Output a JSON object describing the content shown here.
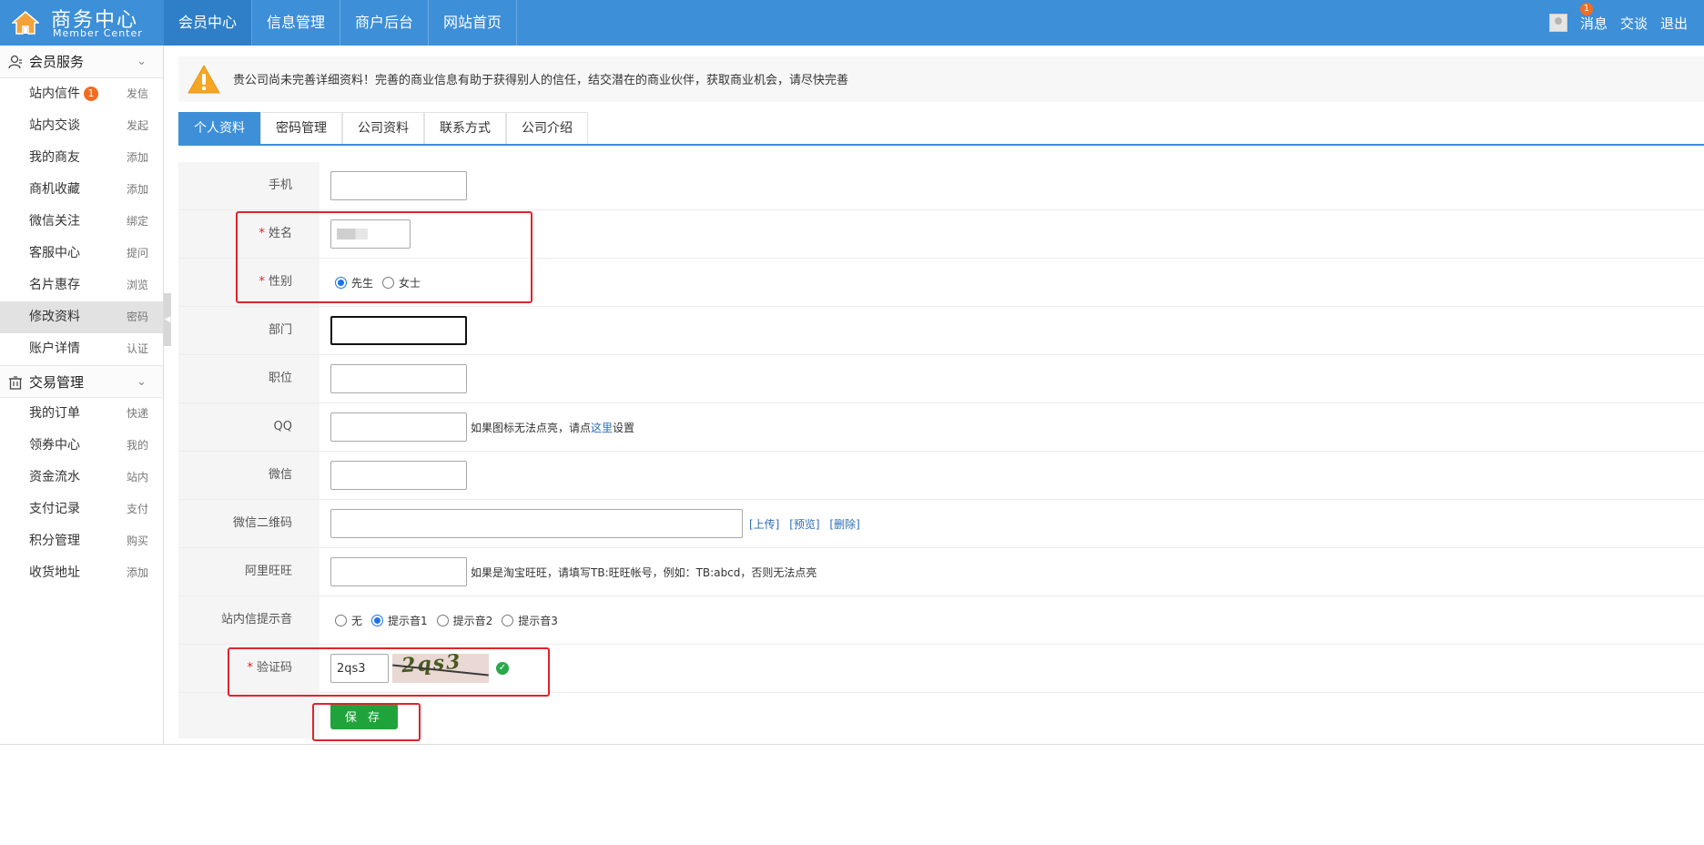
{
  "header": {
    "logo_title": "商务中心",
    "logo_subtitle": "Member Center",
    "nav": [
      {
        "label": "会员中心"
      },
      {
        "label": "信息管理"
      },
      {
        "label": "商户后台"
      },
      {
        "label": "网站首页"
      }
    ],
    "messages_label": "消息",
    "messages_badge": "1",
    "chat_label": "交谈",
    "logout_label": "退出"
  },
  "sidebar": {
    "sections": [
      {
        "title": "会员服务",
        "items": [
          {
            "label": "站内信件",
            "badge": "1",
            "action": "发信"
          },
          {
            "label": "站内交谈",
            "action": "发起"
          },
          {
            "label": "我的商友",
            "action": "添加"
          },
          {
            "label": "商机收藏",
            "action": "添加"
          },
          {
            "label": "微信关注",
            "action": "绑定"
          },
          {
            "label": "客服中心",
            "action": "提问"
          },
          {
            "label": "名片惠存",
            "action": "浏览"
          },
          {
            "label": "修改资料",
            "action": "密码"
          },
          {
            "label": "账户详情",
            "action": "认证"
          }
        ]
      },
      {
        "title": "交易管理",
        "items": [
          {
            "label": "我的订单",
            "action": "快递"
          },
          {
            "label": "领券中心",
            "action": "我的"
          },
          {
            "label": "资金流水",
            "action": "站内"
          },
          {
            "label": "支付记录",
            "action": "支付"
          },
          {
            "label": "积分管理",
            "action": "购买"
          },
          {
            "label": "收货地址",
            "action": "添加"
          }
        ]
      }
    ]
  },
  "notice": {
    "text": "贵公司尚未完善详细资料！完善的商业信息有助于获得别人的信任，结交潜在的商业伙伴，获取商业机会，请尽快完善"
  },
  "tabs": [
    {
      "label": "个人资料"
    },
    {
      "label": "密码管理"
    },
    {
      "label": "公司资料"
    },
    {
      "label": "联系方式"
    },
    {
      "label": "公司介绍"
    }
  ],
  "form": {
    "mobile_label": "手机",
    "mobile_value": "",
    "name_label": "姓名",
    "gender_label": "性别",
    "gender_options": [
      "先生",
      "女士"
    ],
    "gender_selected": "先生",
    "department_label": "部门",
    "position_label": "职位",
    "qq_label": "QQ",
    "qq_hint_before": "如果图标无法点亮，请点",
    "qq_hint_link": "这里",
    "qq_hint_after": "设置",
    "wechat_label": "微信",
    "wechat_qr_label": "微信二维码",
    "wechat_qr_links": [
      "[上传]",
      "[预览]",
      "[删除]"
    ],
    "wangwang_label": "阿里旺旺",
    "wangwang_hint": "如果是淘宝旺旺，请填写TB:旺旺帐号，例如：TB:abcd，否则无法点亮",
    "sound_label": "站内信提示音",
    "sound_options": [
      "无",
      "提示音1",
      "提示音2",
      "提示音3"
    ],
    "sound_selected": "提示音1",
    "captcha_label": "验证码",
    "captcha_value": "2qs3",
    "captcha_image_text": "2qs3",
    "save_label": "保 存"
  },
  "colors": {
    "header_bg": "#3d8fd8",
    "badge": "#f36c21",
    "save_button": "#21a33b",
    "highlight_box": "#e0242a"
  }
}
